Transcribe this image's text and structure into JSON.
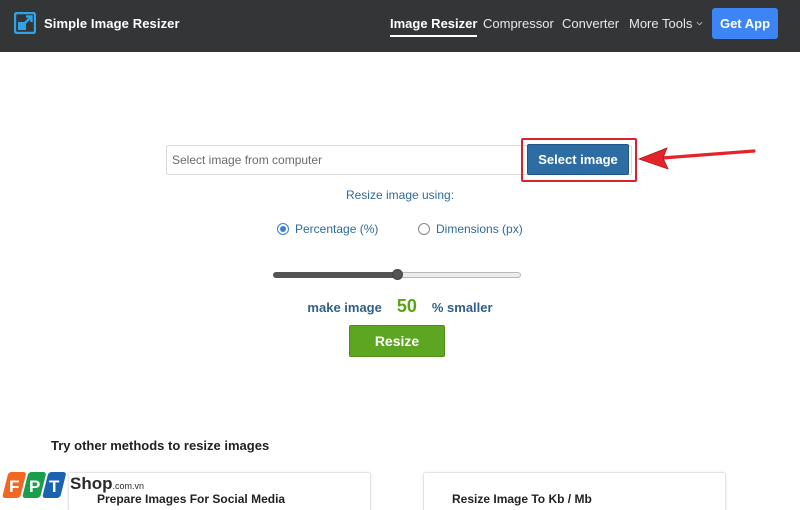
{
  "header": {
    "brand_name": "Simple Image Resizer",
    "brand_icon": "resize-arrow-icon",
    "nav": [
      {
        "label": "Image Resizer",
        "active": true
      },
      {
        "label": "Compressor",
        "active": false
      },
      {
        "label": "Converter",
        "active": false
      },
      {
        "label": "More Tools",
        "active": false
      }
    ],
    "get_app_label": "Get App"
  },
  "uploader": {
    "placeholder": "Select image from computer",
    "select_button_label": "Select image"
  },
  "options": {
    "resize_using_label": "Resize image using:",
    "radios": [
      {
        "label": "Percentage (%)",
        "checked": true
      },
      {
        "label": "Dimensions (px)",
        "checked": false
      }
    ],
    "slider_value_percent": 50,
    "make_image_label": "make image",
    "value": "50",
    "smaller_label": "% smaller",
    "resize_button_label": "Resize"
  },
  "other_methods": {
    "title": "Try other methods to resize images",
    "cards": [
      {
        "title": "Prepare Images For Social Media"
      },
      {
        "title": "Resize Image To Kb / Mb"
      }
    ]
  },
  "watermark": {
    "shop": "Shop",
    "domain": ".com.vn"
  },
  "colors": {
    "header_bg": "#333537",
    "accent_blue": "#3d85f5",
    "select_button": "#2d6da4",
    "resize_green": "#5ca622",
    "highlight_red": "#d8232a"
  }
}
